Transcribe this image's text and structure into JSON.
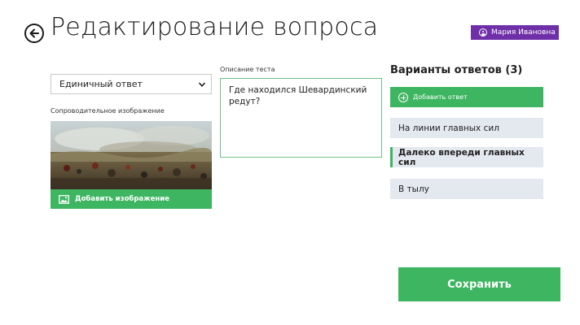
{
  "header": {
    "title": "Редактирование вопроса",
    "user_name": "Мария Ивановна"
  },
  "question": {
    "type_selected": "Единичный ответ",
    "image_label": "Сопроводительное изображение",
    "add_image_label": "Добавить изображение",
    "description_label": "Описание теста",
    "description_value": "Где находился Шевардинский редут?"
  },
  "answers": {
    "title": "Варианты ответов (3)",
    "add_label": "Добавить ответ",
    "items": [
      {
        "label": "На линии главных сил",
        "selected": false
      },
      {
        "label": "Далеко впереди главных сил",
        "selected": true
      },
      {
        "label": "В тылу",
        "selected": false
      }
    ]
  },
  "actions": {
    "save_label": "Сохранить"
  },
  "colors": {
    "accent_green": "#3db561",
    "user_badge_purple": "#6e2fa8",
    "answer_bg": "#e4e8ef"
  }
}
